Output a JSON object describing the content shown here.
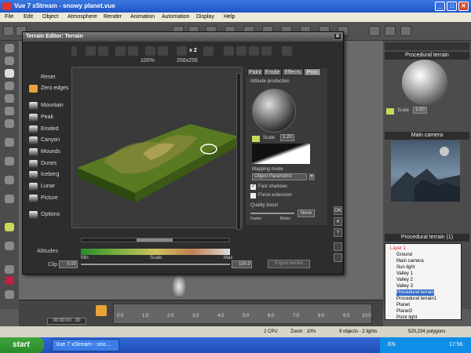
{
  "window": {
    "title": "Vue 7 xStream - snowy planet.vue"
  },
  "menu": [
    "File",
    "Edit",
    "Object",
    "Atmosphere",
    "Render",
    "Animation",
    "Automation",
    "Display",
    "Help"
  ],
  "dialog": {
    "title": "Terrain Editor: Terrain",
    "zoom_label": "100%",
    "size_label": "256x256",
    "x2_label": "x 2",
    "sidebar": [
      {
        "label": "Reset",
        "icon": "reset-icon"
      },
      {
        "label": "Zero edges",
        "icon": "zero-edges-icon"
      },
      {
        "label": "Mountain",
        "icon": "mountain-icon"
      },
      {
        "label": "Peak",
        "icon": "peak-icon"
      },
      {
        "label": "Eroded",
        "icon": "eroded-icon"
      },
      {
        "label": "Canyon",
        "icon": "canyon-icon"
      },
      {
        "label": "Mounds",
        "icon": "mounds-icon"
      },
      {
        "label": "Dunes",
        "icon": "dunes-icon"
      },
      {
        "label": "Iceberg",
        "icon": "iceberg-icon"
      },
      {
        "label": "Lunar",
        "icon": "lunar-icon"
      },
      {
        "label": "Picture",
        "icon": "picture-icon"
      },
      {
        "label": "Options",
        "icon": "options-icon"
      }
    ],
    "tabs": [
      "Paint",
      "Erode",
      "Effects",
      "Proc"
    ],
    "altitude_production_label": "Altitude production",
    "scale_value": "1.20",
    "mapping_mode_label": "Mapping mode",
    "mapping_mode_value": "Object Parametric",
    "fast_shadows": "Fast shadows",
    "force_extension": "Force extension",
    "quality_boost": "Quality boost",
    "faster": "Faster",
    "better": "Better",
    "none_btn": "None",
    "altitudes_label": "Altitudes",
    "min_label": "Min",
    "scale_label": "Scale",
    "max_label": "Max",
    "clip_label": "Clip",
    "clip_min": "0.00",
    "clip_max": "100.0",
    "export_btn": "Export terrain",
    "ok": "OK",
    "cancel": "✕",
    "help": "?"
  },
  "right_panel": {
    "procedural_terrain": "Procedural terrain",
    "scale_label": "Scale",
    "scale_value": "1.00",
    "main_camera": "Main camera",
    "layer_header": "Procedural terrain (1)",
    "layers": [
      "Layer 1",
      "Ground",
      "Main camera",
      "Sun light",
      "Valley 1",
      "Valley 2",
      "Valley 3",
      "Procedural terrain",
      "Procedural terrain1",
      "Planet",
      "Planet2",
      "Point light"
    ]
  },
  "timeline": {
    "time": "00:00:00 . 00",
    "ticks": [
      "0:0",
      "1:0",
      "2:0",
      "3:0",
      "4:0",
      "5:0",
      "6:0",
      "7:0",
      "8:0",
      "9:0",
      "10:0"
    ]
  },
  "status": {
    "cpu": "2 CPU",
    "zoom": "Zoom : 10%",
    "objects": "9 objects - 2 lights",
    "polygons": "520,234 polygons"
  },
  "taskbar": {
    "start": "start",
    "task": "Vue 7 xStream - sno...",
    "lang": "EN",
    "clock": "17:56"
  }
}
